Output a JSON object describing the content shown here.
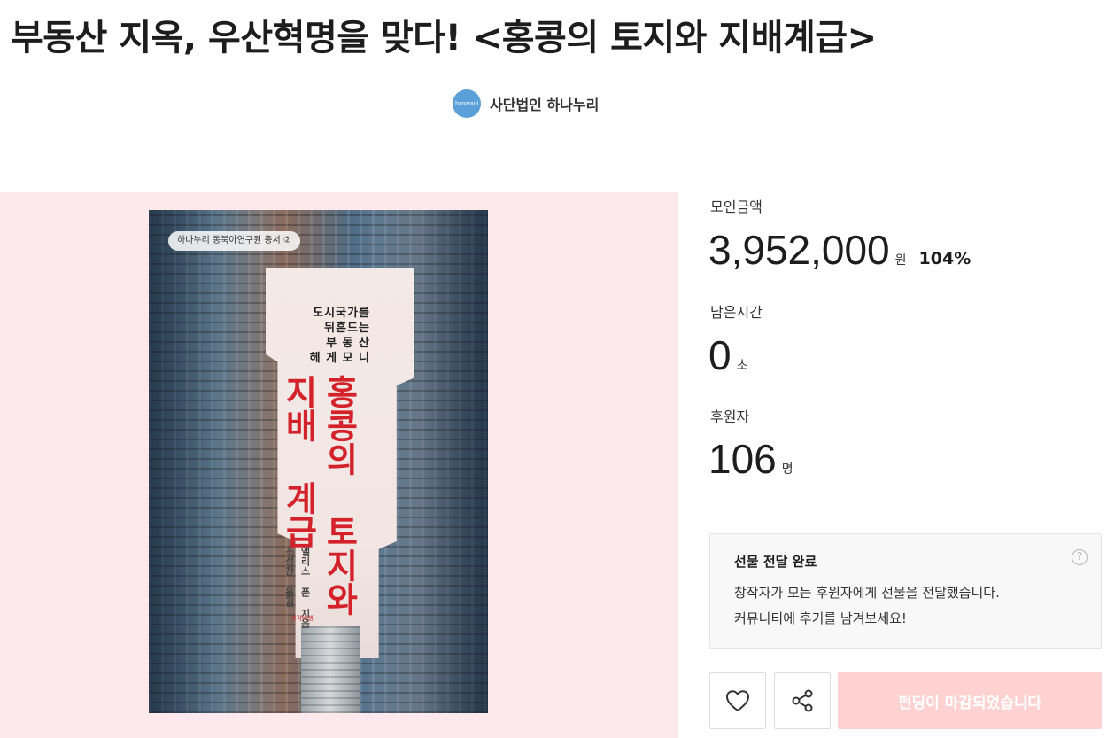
{
  "project": {
    "title": "부동산 지옥, 우산혁명을 맞다! <홍콩의 토지와 지배계급>",
    "creator": {
      "name": "사단법인 하나누리",
      "avatar_text": "hananuri"
    }
  },
  "cover": {
    "series": "하나누리 동북아연구원 총서 ②",
    "subtitle_lines": [
      "도시국가를",
      "뒤흔드는",
      "부 동 산",
      "헤 게 모 니"
    ],
    "title_col_1": "홍콩의 토지와",
    "title_col_2": "지배 계급",
    "author": "앨리스 푼 지음",
    "translator": "조성찬 옮김",
    "publisher": "생각비행"
  },
  "stats": {
    "amount_label": "모인금액",
    "amount_value": "3,952,000",
    "amount_unit": "원",
    "amount_percent": "104%",
    "time_label": "남은시간",
    "time_value": "0",
    "time_unit": "초",
    "backers_label": "후원자",
    "backers_value": "106",
    "backers_unit": "명"
  },
  "notice": {
    "title": "선물 전달 완료",
    "line1": "창작자가 모든 후원자에게 선물을 전달했습니다.",
    "line2": "커뮤니티에 후기를 남겨보세요!",
    "help_icon": "question-circle-icon"
  },
  "actions": {
    "like_icon": "heart-icon",
    "share_icon": "share-icon",
    "fund_button_label": "펀딩이 마감되었습니다"
  },
  "colors": {
    "image_bg": "#fde9eb",
    "cover_title_red": "#d3222a",
    "fund_button_bg": "#ffd2d2",
    "avatar_bg": "#5a9fd8"
  }
}
